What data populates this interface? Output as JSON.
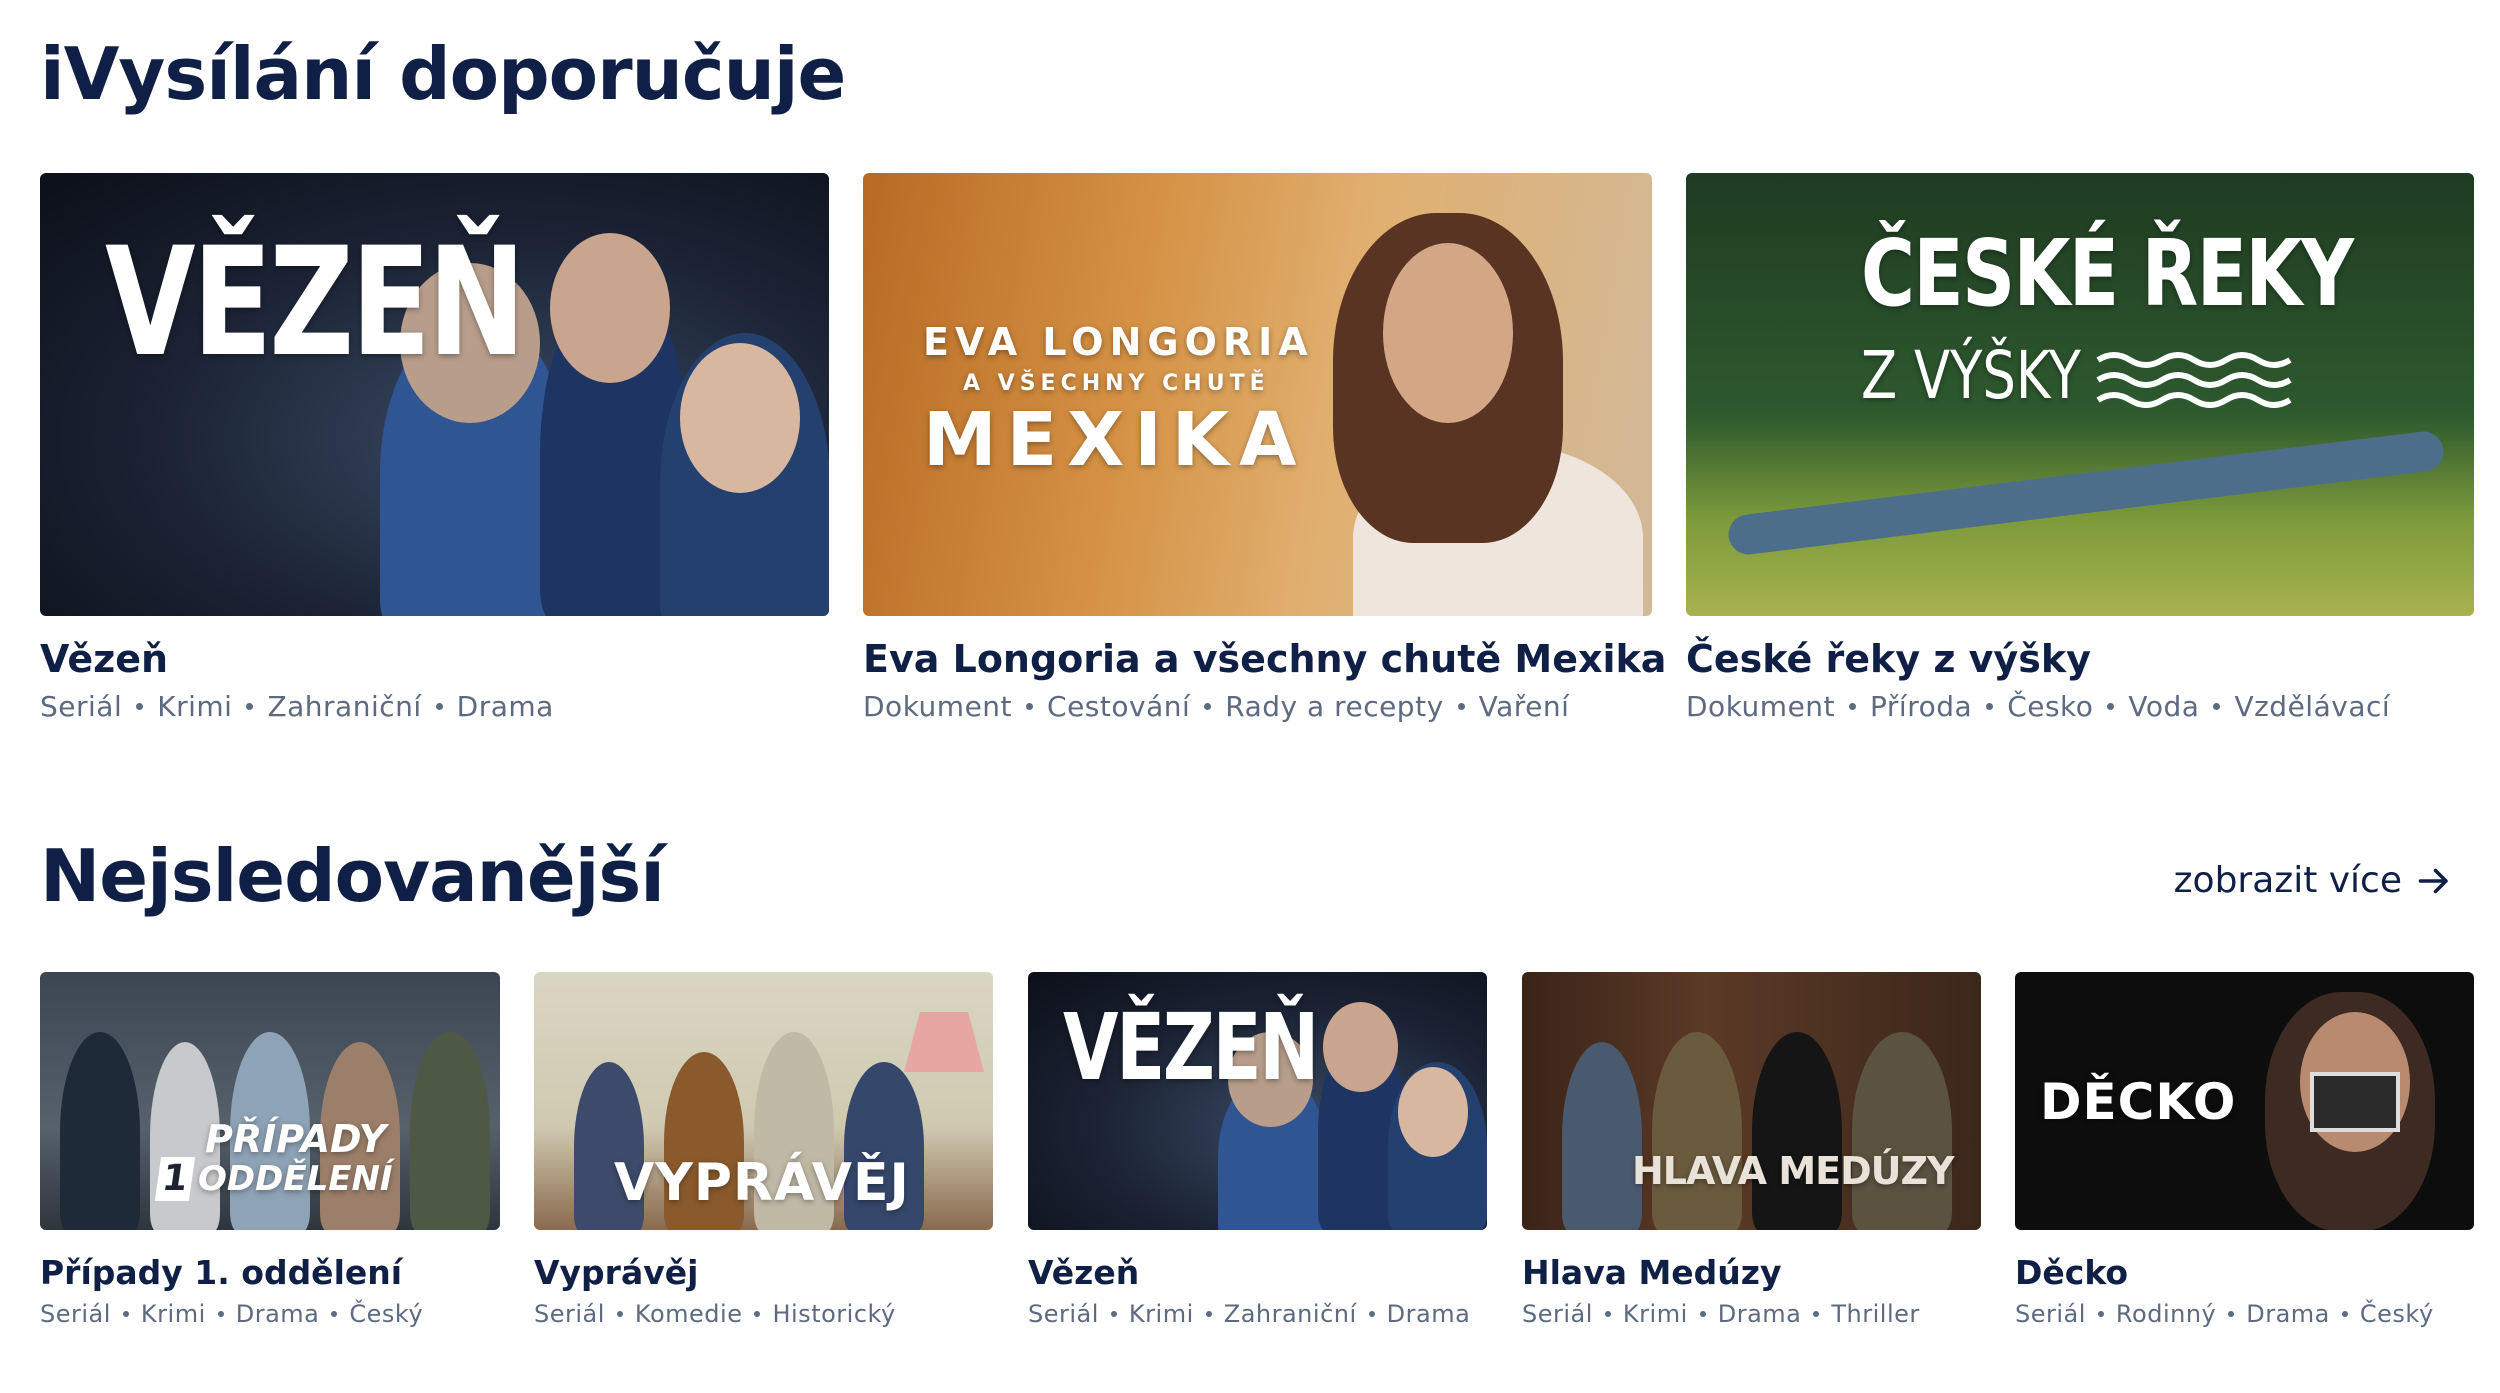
{
  "recommended": {
    "title": "iVysílání doporučuje",
    "cards": [
      {
        "title": "Vězeň",
        "logo": "VĚZEŇ",
        "tags": [
          "Seriál",
          "Krimi",
          "Zahraniční",
          "Drama"
        ]
      },
      {
        "title": "Eva Longoria a všechny chutě Mexika",
        "logo_line1": "EVA LONGORIA",
        "logo_line2": "A VŠECHNY CHUTĚ",
        "logo_line3": "MEXIKA",
        "tags": [
          "Dokument",
          "Cestování",
          "Rady a recepty",
          "Vaření"
        ]
      },
      {
        "title": "České řeky z výšky",
        "logo_line1": "ČESKÉ ŘEKY",
        "logo_line2": "Z VÝŠKY",
        "tags": [
          "Dokument",
          "Příroda",
          "Česko",
          "Voda",
          "Vzdělávací"
        ]
      }
    ]
  },
  "most_watched": {
    "title": "Nejsledovanější",
    "more_label": "zobrazit více",
    "cards": [
      {
        "title": "Případy 1. oddělení",
        "logo_line1": "PŘÍPADY",
        "logo_num": "1",
        "logo_line2": "ODDĚLENÍ",
        "tags": [
          "Seriál",
          "Krimi",
          "Drama",
          "Český"
        ]
      },
      {
        "title": "Vyprávěj",
        "logo": "VYPRÁVĚJ",
        "tags": [
          "Seriál",
          "Komedie",
          "Historický"
        ]
      },
      {
        "title": "Vězeň",
        "logo": "VĚZEŇ",
        "tags": [
          "Seriál",
          "Krimi",
          "Zahraniční",
          "Drama"
        ]
      },
      {
        "title": "Hlava Medúzy",
        "logo": "HLAVA MEDÚZY",
        "tags": [
          "Seriál",
          "Krimi",
          "Drama",
          "Thriller"
        ]
      },
      {
        "title": "Děcko",
        "logo": "DĚCKO",
        "tags": [
          "Seriál",
          "Rodinný",
          "Drama",
          "Český"
        ]
      }
    ]
  },
  "colors": {
    "heading": "#0f1f45",
    "tag": "#5d6a80",
    "background": "#ffffff"
  },
  "icons": {
    "more": "arrow-right-icon"
  }
}
